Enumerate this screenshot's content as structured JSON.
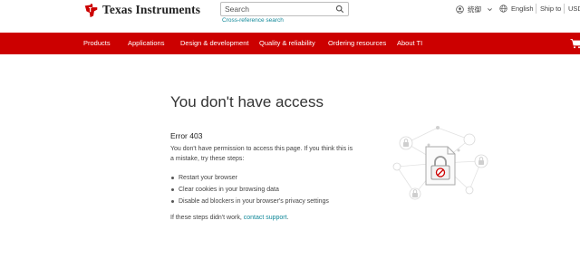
{
  "header": {
    "brand": "Texas Instruments",
    "search": {
      "placeholder": "Search",
      "value": ""
    },
    "cross_reference": "Cross-reference search",
    "user_label": "统御",
    "language": "English",
    "ship_to": "Ship to",
    "currency": "USD"
  },
  "nav": {
    "items": [
      "Products",
      "Applications",
      "Design & development",
      "Quality & reliability",
      "Ordering resources",
      "About TI"
    ]
  },
  "content": {
    "title": "You don't have access",
    "error_code": "Error 403",
    "description": "You don't have permission to access this page. If you think this is a mistake, try these steps:",
    "steps": [
      "Restart your browser",
      "Clear cookies in your browsing data",
      "Disable ad blockers in your browser's privacy settings"
    ],
    "contact_prefix": "If these steps didn't work, ",
    "contact_link": "contact support",
    "contact_suffix": "."
  },
  "colors": {
    "brand_red": "#cc0000",
    "link_teal": "#118899",
    "text": "#333333"
  },
  "icons": [
    "ti-logo-icon",
    "search-icon",
    "user-icon",
    "chevron-down-icon",
    "globe-icon",
    "cart-icon",
    "locked-file-icon",
    "padlock-icon"
  ]
}
